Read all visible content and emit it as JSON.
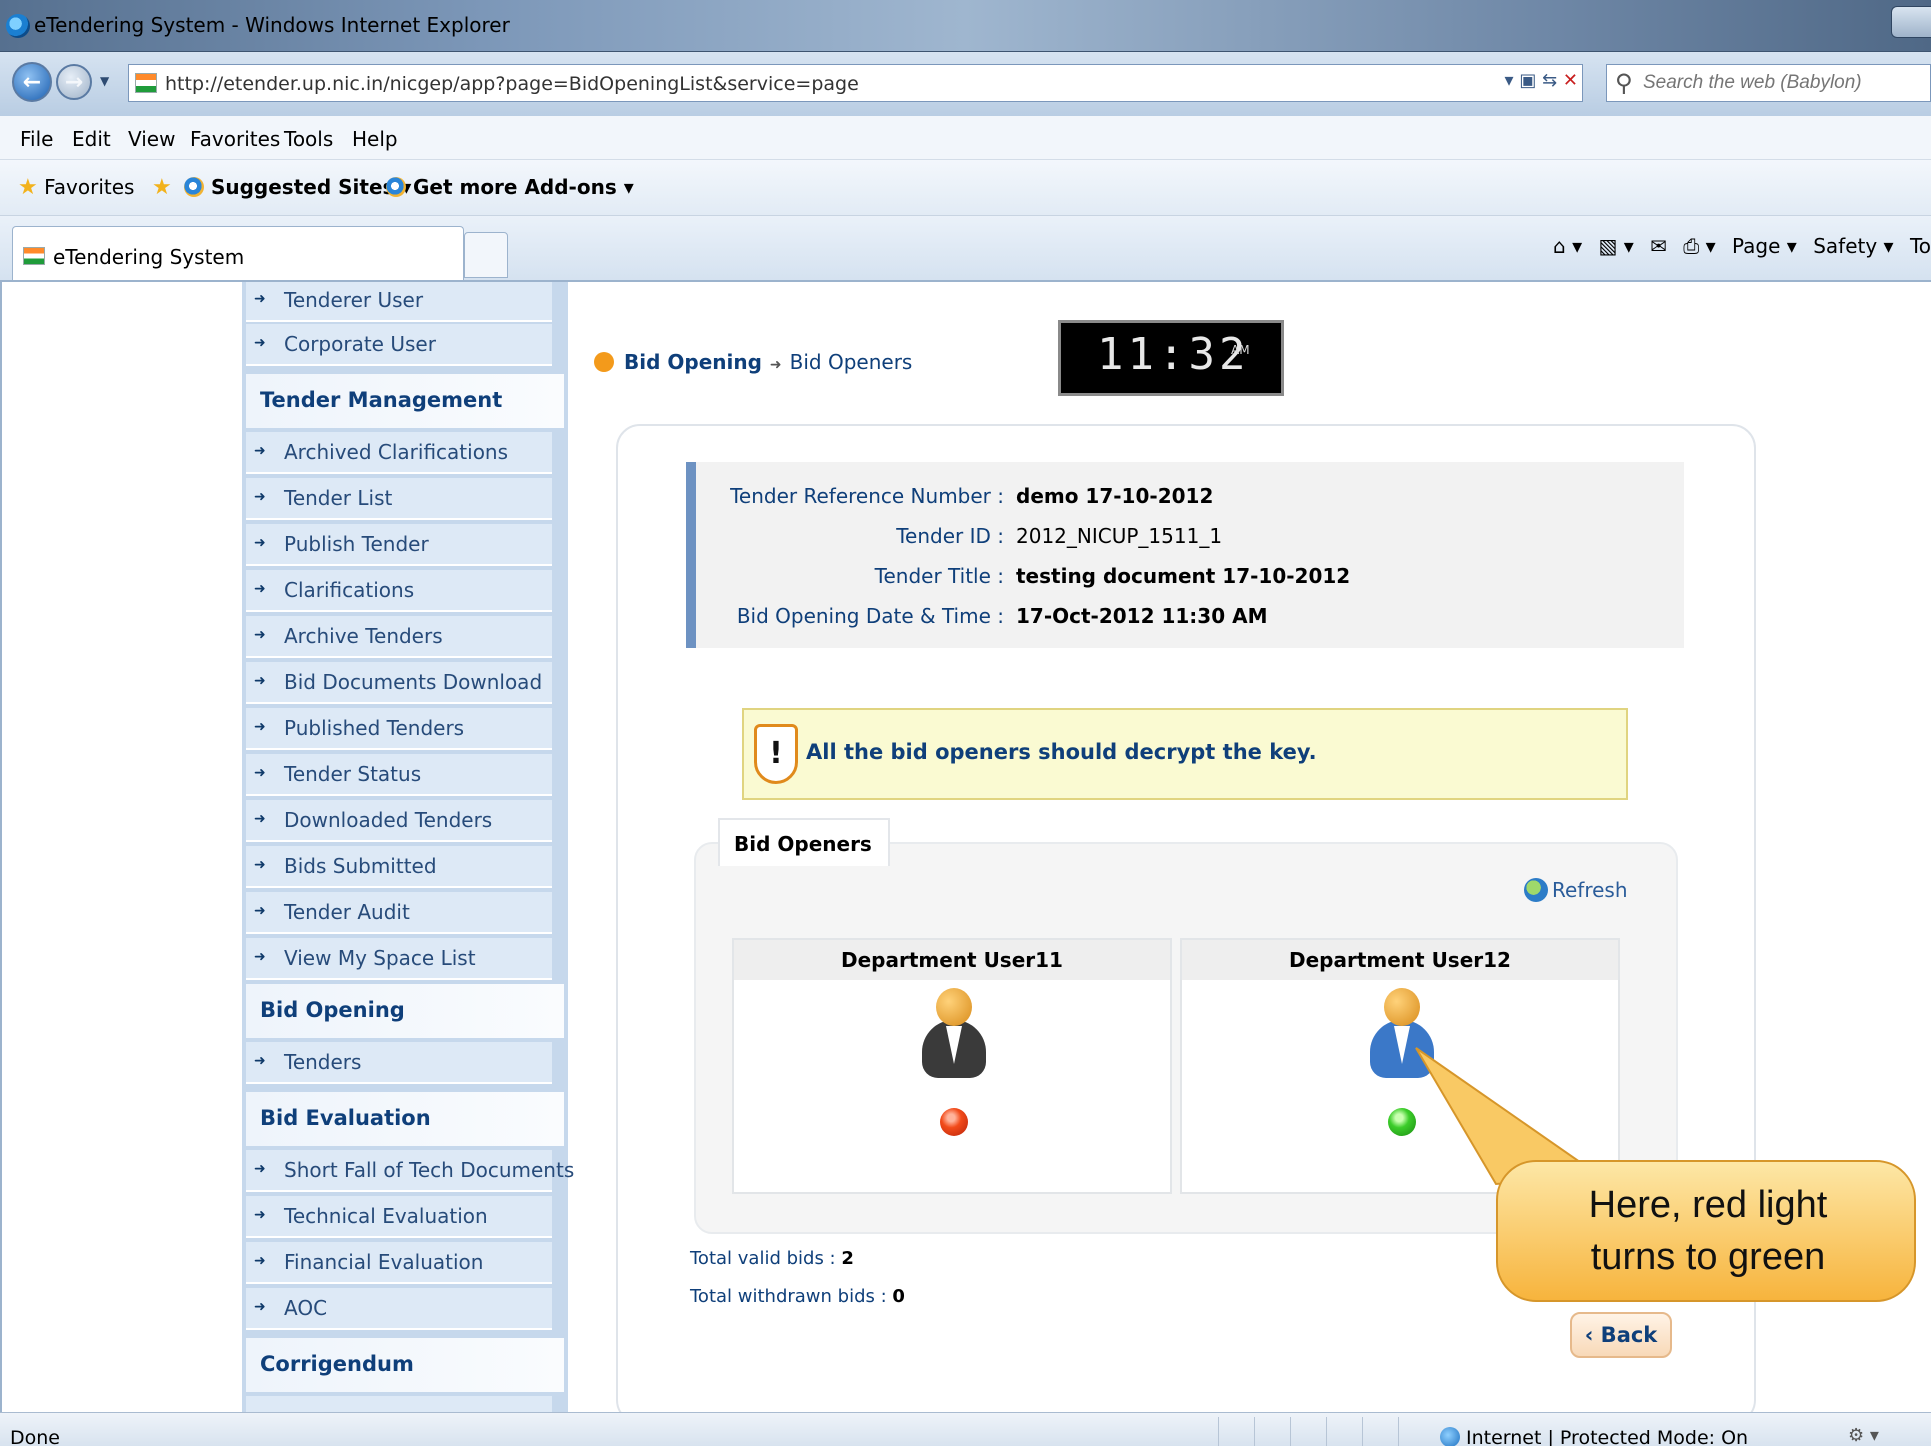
{
  "window": {
    "title": "eTendering System - Windows Internet Explorer"
  },
  "navbar": {
    "url": "http://etender.up.nic.in/nicgep/app?page=BidOpeningList&service=page",
    "search_placeholder": "Search the web (Babylon)"
  },
  "menu": [
    "File",
    "Edit",
    "View",
    "Favorites",
    "Tools",
    "Help"
  ],
  "favorites": {
    "favorites_label": "Favorites",
    "suggested_label": "Suggested Sites ▾",
    "addons_label": "Get more Add-ons ▾"
  },
  "tab": {
    "label": "eTendering System"
  },
  "commandbar": {
    "page": "Page ▾",
    "safety": "Safety ▾",
    "tools": "To"
  },
  "sidebar": {
    "items_top": [
      "Tenderer User",
      "Corporate User"
    ],
    "tender_management": {
      "heading": "Tender Management",
      "items": [
        "Archived Clarifications",
        "Tender List",
        "Publish Tender",
        "Clarifications",
        "Archive Tenders",
        "Bid Documents Download",
        "Published Tenders",
        "Tender Status",
        "Downloaded Tenders",
        "Bids Submitted",
        "Tender Audit",
        "View My Space List"
      ]
    },
    "bid_opening": {
      "heading": "Bid Opening",
      "items": [
        "Tenders"
      ]
    },
    "bid_evaluation": {
      "heading": "Bid Evaluation",
      "items": [
        "Short Fall of Tech Documents",
        "Technical Evaluation",
        "Financial Evaluation",
        "AOC"
      ]
    },
    "corrigendum": {
      "heading": "Corrigendum"
    }
  },
  "breadcrumb": {
    "level1": "Bid Opening",
    "level2": "Bid Openers"
  },
  "clock": {
    "time": "11:32",
    "ampm": "AM"
  },
  "tender": {
    "ref_label": "Tender Reference Number :",
    "ref_value": "demo 17-10-2012",
    "id_label": "Tender ID :",
    "id_value": "2012_NICUP_1511_1",
    "title_label": "Tender Title :",
    "title_value": "testing document 17-10-2012",
    "date_label": "Bid Opening Date & Time :",
    "date_value": "17-Oct-2012 11:30 AM"
  },
  "alert": {
    "message": "All the bid openers should decrypt the key."
  },
  "bid_openers": {
    "tab_label": "Bid Openers",
    "refresh_label": "Refresh",
    "users": [
      {
        "name": "Department User11",
        "status": "red",
        "avatar_color": "#3a3a3a"
      },
      {
        "name": "Department User12",
        "status": "green",
        "avatar_color": "#3b78c8"
      }
    ]
  },
  "totals": {
    "valid_label": "Total valid bids :",
    "valid_value": "2",
    "withdrawn_label": "Total withdrawn bids :",
    "withdrawn_value": "0"
  },
  "back_button": "‹ Back",
  "callout": {
    "line1": "Here, red light",
    "line2": "turns to green"
  },
  "statusbar": {
    "left": "Done",
    "zone": "Internet | Protected Mode: On"
  }
}
